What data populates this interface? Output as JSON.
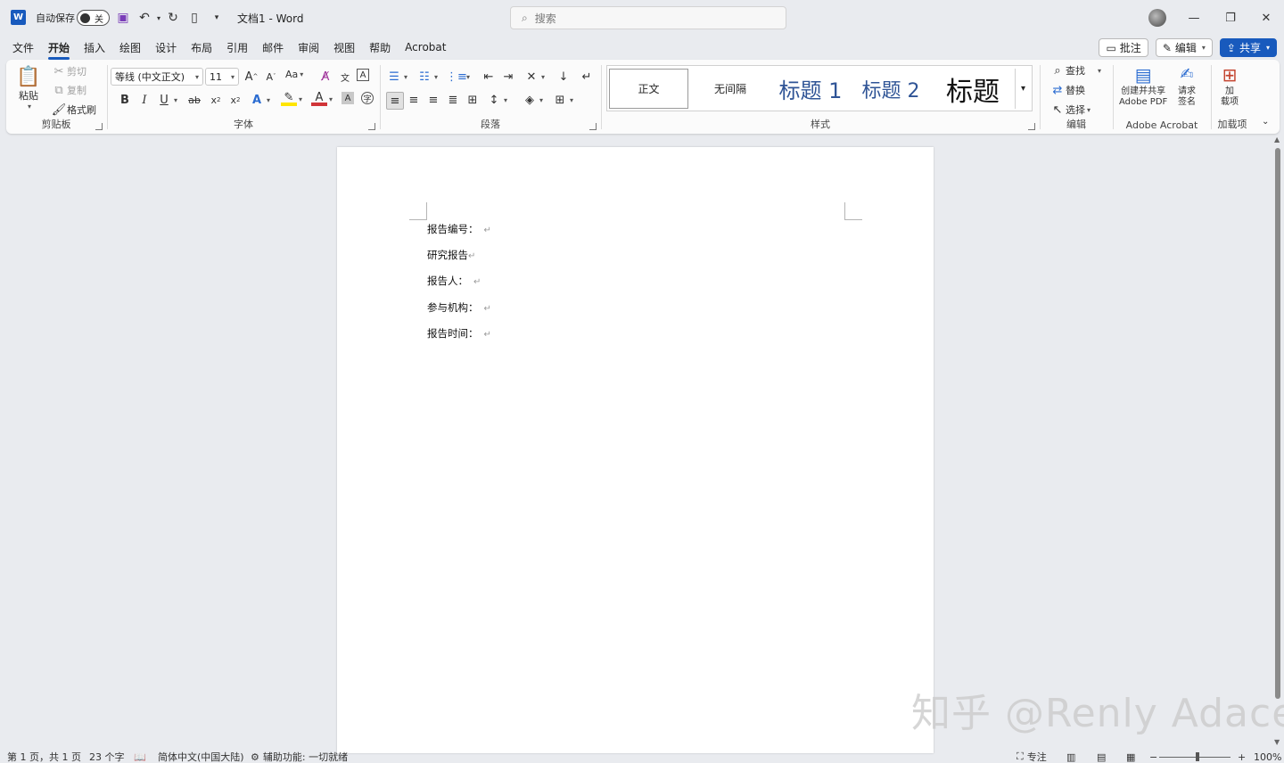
{
  "titlebar": {
    "app_logo": "W",
    "autosave_label": "自动保存",
    "autosave_state": "关",
    "doc_title": "文档1  -  Word",
    "search_placeholder": "搜索",
    "icons": [
      "save-icon",
      "undo-icon",
      "redo-icon",
      "new-doc-icon",
      "customize-icon"
    ]
  },
  "menu": {
    "tabs": [
      "文件",
      "开始",
      "插入",
      "绘图",
      "设计",
      "布局",
      "引用",
      "邮件",
      "审阅",
      "视图",
      "帮助",
      "Acrobat"
    ],
    "active": "开始",
    "comment_label": "批注",
    "edit_label": "编辑",
    "share_label": "共享"
  },
  "ribbon": {
    "clipboard": {
      "paste": "粘贴",
      "cut": "剪切",
      "copy": "复制",
      "format_painter": "格式刷",
      "label": "剪贴板"
    },
    "font": {
      "font_name": "等线 (中文正文)",
      "font_size": "11",
      "case_label": "Aa",
      "label": "字体"
    },
    "paragraph": {
      "label": "段落"
    },
    "styles": {
      "items": [
        "正文",
        "无间隔",
        "标题 1",
        "标题 2",
        "标题"
      ],
      "label": "样式"
    },
    "editing": {
      "find": "查找",
      "replace": "替换",
      "select": "选择",
      "label": "编辑"
    },
    "acrobat": {
      "create_share_line1": "创建并共享",
      "create_share_line2": "Adobe PDF",
      "request_sign_line1": "请求",
      "request_sign_line2": "签名",
      "label": "Adobe Acrobat"
    },
    "addins": {
      "line1": "加",
      "line2": "载项",
      "label": "加载项"
    }
  },
  "document": {
    "paragraphs": [
      "报告编号：",
      "研究报告",
      "报告人：",
      "参与机构：",
      "报告时间："
    ],
    "para_mark": "↵"
  },
  "watermark": "知乎 @Renly Adace",
  "status": {
    "page": "第 1 页，共 1 页",
    "words": "23 个字",
    "language": "简体中文(中国大陆)",
    "accessibility": "辅助功能: 一切就绪",
    "focus": "专注",
    "zoom": "100%"
  }
}
